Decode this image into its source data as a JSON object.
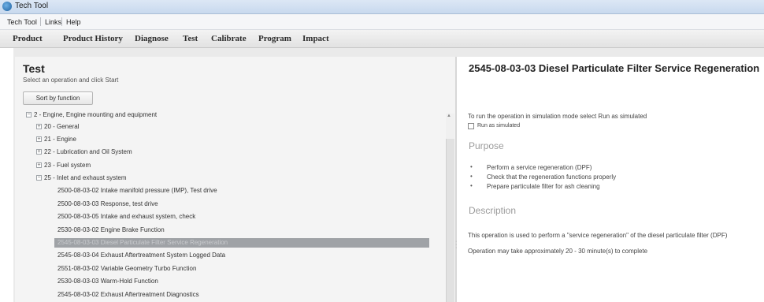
{
  "window": {
    "title": "Tech Tool"
  },
  "menu": {
    "items": [
      "Tech Tool",
      "Links",
      "Help"
    ]
  },
  "tabs": [
    "Product",
    "Product History",
    "Diagnose",
    "Test",
    "Calibrate",
    "Program",
    "Impact"
  ],
  "left": {
    "title": "Test",
    "subtitle": "Select an operation and click Start",
    "sort_button": "Sort by function",
    "tree": [
      {
        "label": "2 - Engine, Engine mounting and equipment",
        "toggle": "−"
      },
      {
        "label": "20 - General",
        "toggle": "+"
      },
      {
        "label": "21 - Engine",
        "toggle": "+"
      },
      {
        "label": "22 - Lubrication and Oil System",
        "toggle": "+"
      },
      {
        "label": "23 - Fuel system",
        "toggle": "+"
      },
      {
        "label": "25 - Inlet and exhaust system",
        "toggle": "−"
      },
      {
        "label": "2500-08-03-02 Intake manifold pressure (IMP), Test drive"
      },
      {
        "label": "2500-08-03-03 Response, test drive"
      },
      {
        "label": "2500-08-03-05 Intake and exhaust system, check"
      },
      {
        "label": "2530-08-03-02 Engine Brake Function"
      },
      {
        "label": "2545-08-03-03 Diesel Particulate Filter Service Regeneration",
        "selected": true
      },
      {
        "label": "2545-08-03-04 Exhaust Aftertreatment System Logged Data"
      },
      {
        "label": "2551-08-03-02 Variable Geometry Turbo Function"
      },
      {
        "label": "2530-08-03-03 Warm-Hold Function"
      },
      {
        "label": "2545-08-03-02 Exhaust Aftertreatment Diagnostics"
      }
    ]
  },
  "right": {
    "title": "2545-08-03-03 Diesel Particulate Filter Service Regeneration",
    "simulation_text": "To run the operation in simulation mode select Run as simulated",
    "checkbox_label": "Run as simulated",
    "purpose_heading": "Purpose",
    "purpose_items": [
      "Perform a service regeneration (DPF)",
      "Check that the regeneration functions properly",
      "Prepare particulate filter for ash cleaning"
    ],
    "description_heading": "Description",
    "description_text": "This operation is used to perform a \"service regeneration\" of the diesel particulate filter (DPF)",
    "duration_text": "Operation may take approximately 20 - 30 minute(s) to complete"
  }
}
